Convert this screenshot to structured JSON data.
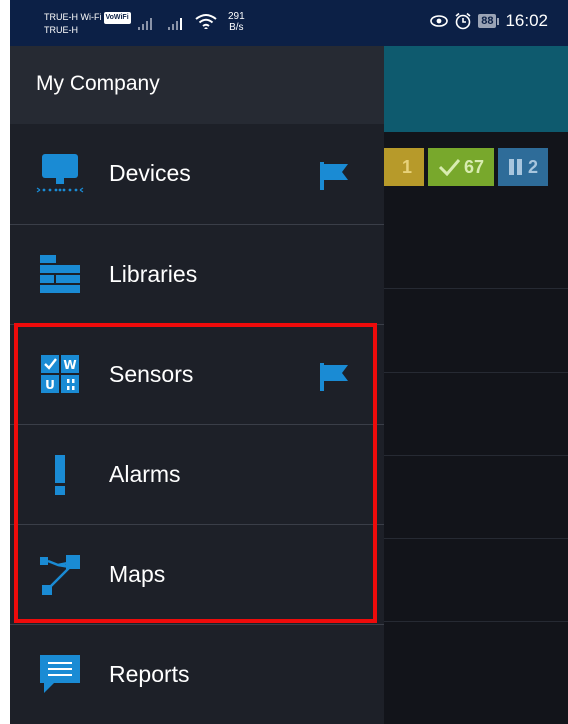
{
  "status_bar": {
    "carrier_line1": "TRUE-H Wi-Fi",
    "volte_badge": "VoWiFi",
    "carrier_line2": "TRUE-H",
    "data_rate_value": "291",
    "data_rate_unit": "B/s",
    "battery": "88",
    "time": "16:02"
  },
  "drawer": {
    "company": "My Company",
    "items": [
      {
        "label": "Devices",
        "icon": "monitor-icon",
        "flag": true
      },
      {
        "label": "Libraries",
        "icon": "libraries-icon",
        "flag": false
      },
      {
        "label": "Sensors",
        "icon": "sensor-grid-icon",
        "flag": true
      },
      {
        "label": "Alarms",
        "icon": "exclamation-icon",
        "flag": false
      },
      {
        "label": "Maps",
        "icon": "map-nodes-icon",
        "flag": false
      },
      {
        "label": "Reports",
        "icon": "chat-bubble-icon",
        "flag": false
      }
    ],
    "highlighted_items": [
      "Sensors",
      "Alarms",
      "Maps"
    ]
  },
  "background_summary": {
    "warning_count": "1",
    "ok_count": "67",
    "paused_count": "2"
  },
  "colors": {
    "icon_blue": "#1a8bd4",
    "highlight_red": "#ee0b0b",
    "drawer_bg": "#1d2028"
  }
}
